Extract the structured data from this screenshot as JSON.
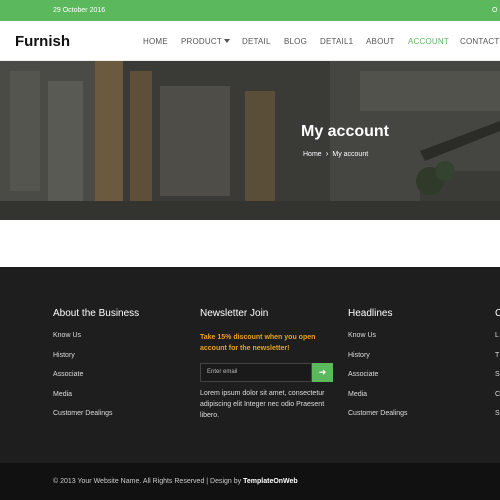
{
  "topbar": {
    "date": "29 October 2016",
    "right_text": "O"
  },
  "header": {
    "logo": "Furnish",
    "nav": [
      "HOME",
      "PRODUCT",
      "DETAIL",
      "BLOG",
      "DETAIL1",
      "ABOUT",
      "ACCOUNT",
      "CONTACT"
    ],
    "active_index": 6
  },
  "hero": {
    "title": "My account",
    "crumb_home": "Home",
    "crumb_sep": "›",
    "crumb_current": "My account"
  },
  "footer": {
    "col1": {
      "title": "About the Business",
      "links": [
        "Know Us",
        "History",
        "Associate",
        "Media",
        "Customer Dealings"
      ]
    },
    "col2": {
      "title": "Newsletter Join",
      "promo": "Take 15% discount when you open account for the newsletter!",
      "email_placeholder": "Enter email",
      "submit_icon": "arrow-right",
      "body": "Lorem ipsum dolor sit amet, consectetur adipiscing elit Integer nec odio Praesent libero."
    },
    "col3": {
      "title": "Headlines",
      "links": [
        "Know Us",
        "History",
        "Associate",
        "Media",
        "Customer Dealings"
      ]
    },
    "col4": {
      "title": "C",
      "links": [
        "L",
        "T",
        "S",
        "C",
        "S"
      ]
    }
  },
  "bottom": {
    "copyright": "© 2013 Your Website Name. All Rights Reserved | Design by",
    "designer": "TemplateOnWeb"
  },
  "colors": {
    "accent": "#5cb85c",
    "promo": "#e8a21e",
    "footer_bg": "#1e1e1e",
    "bottom_bg": "#111111"
  }
}
